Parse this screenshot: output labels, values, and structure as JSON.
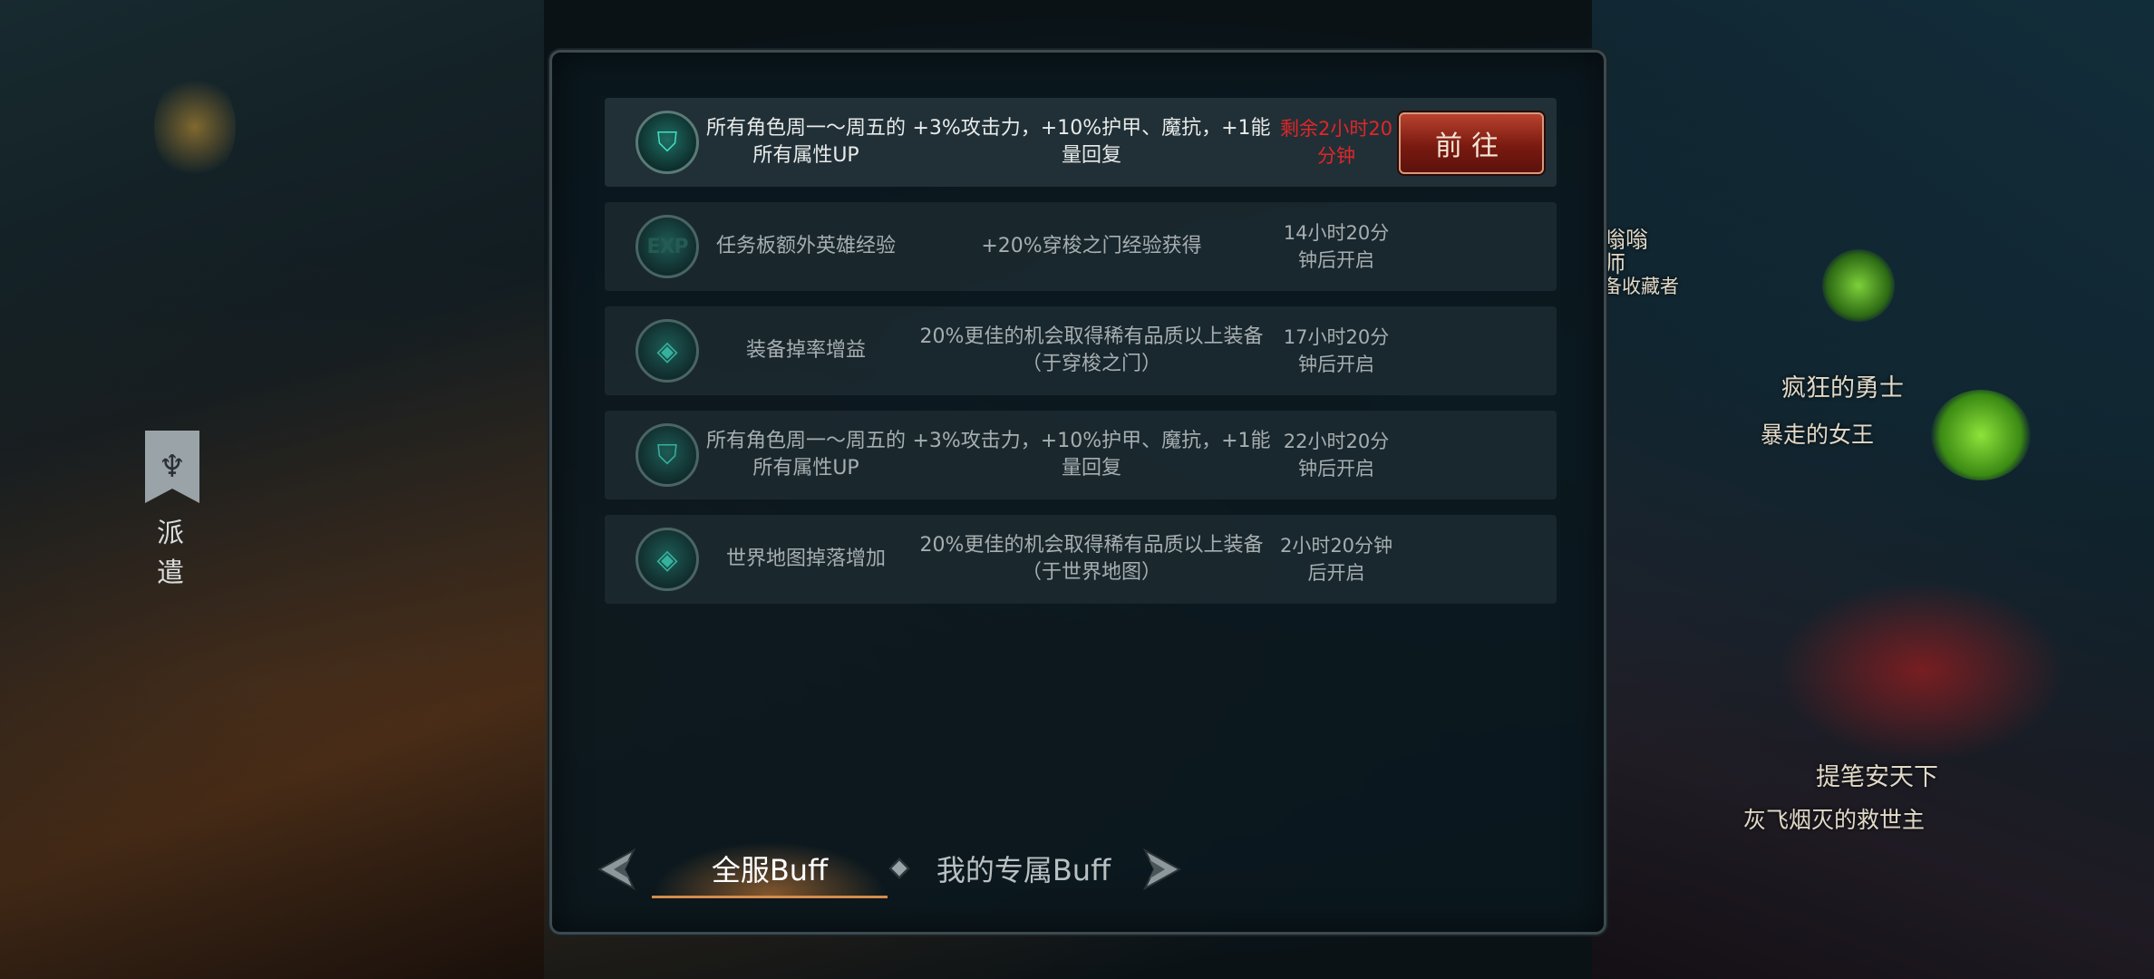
{
  "side_tab": {
    "icon": "demon-crest-icon",
    "label": "派 遣"
  },
  "right_labels": [
    "嗡嗡",
    "师",
    "备收藏者",
    "疯狂的勇士",
    "暴走的女王",
    "提笔安天下",
    "灰飞烟灭的救世主"
  ],
  "buffs": [
    {
      "icon": "shield-icon",
      "name": "所有角色周一～周五的所有属性UP",
      "desc": "+3%攻击力，+10%护甲、魔抗，+1能量回复",
      "time": "剩余2小时20分钟",
      "active": true,
      "button": "前往"
    },
    {
      "icon": "exp-icon",
      "name": "任务板额外英雄经验",
      "desc": "+20%穿梭之门经验获得",
      "time": "14小时20分钟后开启",
      "active": false
    },
    {
      "icon": "gem-icon",
      "name": "装备掉率增益",
      "desc": "20%更佳的机会取得稀有品质以上装备（于穿梭之门）",
      "time": "17小时20分钟后开启",
      "active": false
    },
    {
      "icon": "shield-icon",
      "name": "所有角色周一～周五的所有属性UP",
      "desc": "+3%攻击力，+10%护甲、魔抗，+1能量回复",
      "time": "22小时20分钟后开启",
      "active": false
    },
    {
      "icon": "gem-icon",
      "name": "世界地图掉落增加",
      "desc": "20%更佳的机会取得稀有品质以上装备（于世界地图）",
      "time": "2小时20分钟后开启",
      "active": false
    }
  ],
  "tabs": {
    "server": "全服Buff",
    "mine": "我的专属Buff"
  },
  "colors": {
    "accent_red": "#e0262a",
    "teal_icon": "#3fe0c4",
    "tab_glow": "#d48c4a"
  }
}
